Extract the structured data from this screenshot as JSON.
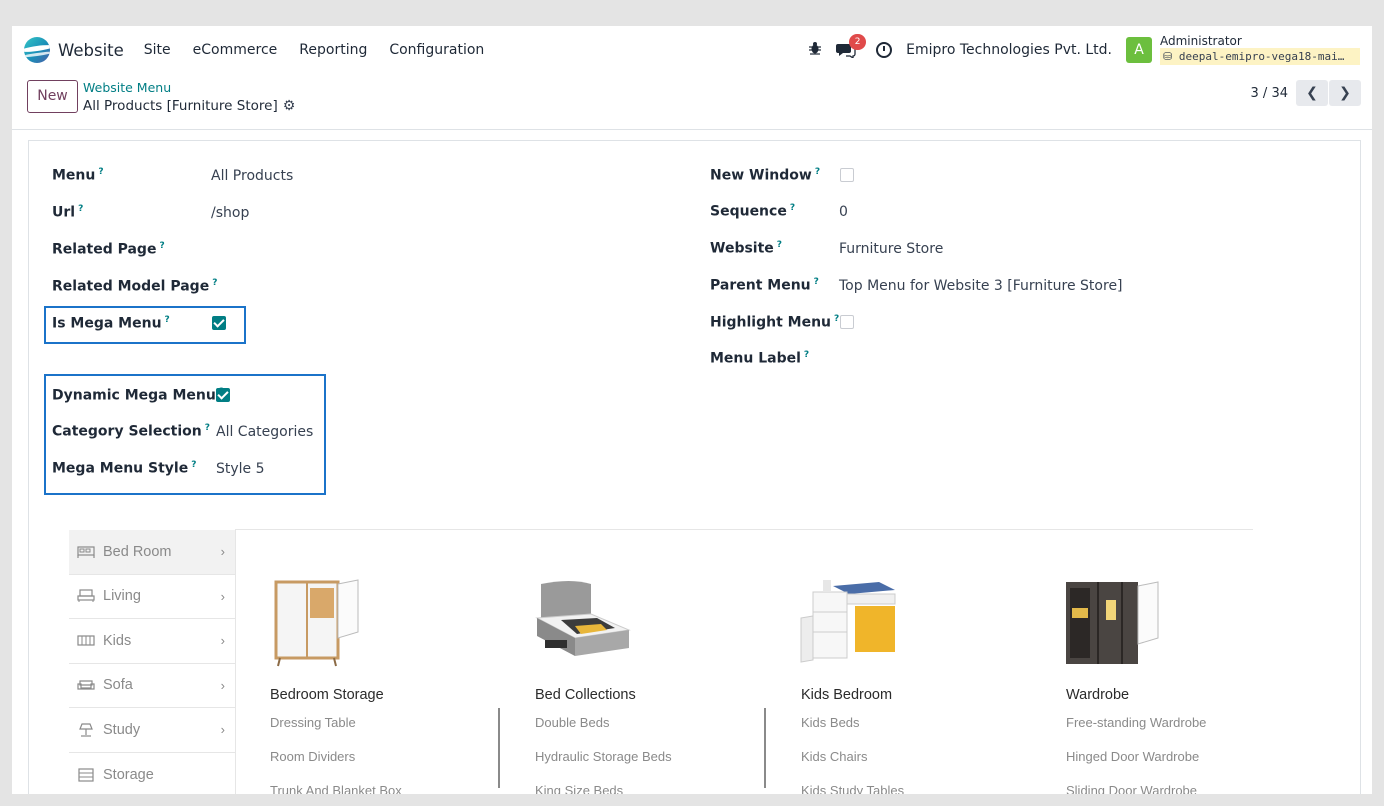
{
  "navbar": {
    "app_name": "Website",
    "menu": [
      "Site",
      "eCommerce",
      "Reporting",
      "Configuration"
    ],
    "messages_count": "2",
    "company": "Emipro Technologies Pvt. Ltd.",
    "user_initial": "A",
    "user_name": "Administrator",
    "database": "deepal-emipro-vega18-mai…"
  },
  "control": {
    "new_label": "New",
    "breadcrumb_parent": "Website Menu",
    "breadcrumb_current": "All Products [Furniture Store]",
    "pager": "3 / 34"
  },
  "form": {
    "left": [
      {
        "label": "Menu",
        "value": "All Products"
      },
      {
        "label": "Url",
        "value": "/shop"
      },
      {
        "label": "Related Page",
        "value": ""
      },
      {
        "label": "Related Model Page",
        "value": ""
      },
      {
        "label": "Is Mega Menu",
        "checked": true
      }
    ],
    "dynamic": [
      {
        "label": "Dynamic Mega Menu",
        "checked": true
      },
      {
        "label": "Category Selection",
        "value": "All Categories"
      },
      {
        "label": "Mega Menu Style",
        "value": "Style 5"
      }
    ],
    "right": [
      {
        "label": "New Window",
        "checked": false
      },
      {
        "label": "Sequence",
        "value": "0"
      },
      {
        "label": "Website",
        "value": "Furniture Store"
      },
      {
        "label": "Parent Menu",
        "value": "Top Menu for Website 3 [Furniture Store]"
      },
      {
        "label": "Highlight Menu",
        "checked": false
      },
      {
        "label": "Menu Label",
        "value": ""
      }
    ],
    "help_marker": "?"
  },
  "preview": {
    "categories": [
      {
        "label": "Bed Room",
        "icon": "bed-icon",
        "active": true
      },
      {
        "label": "Living",
        "icon": "living-icon",
        "active": false
      },
      {
        "label": "Kids",
        "icon": "crib-icon",
        "active": false
      },
      {
        "label": "Sofa",
        "icon": "sofa-icon",
        "active": false
      },
      {
        "label": "Study",
        "icon": "lamp-icon",
        "active": false
      },
      {
        "label": "Storage",
        "icon": "storage-icon",
        "active": false
      }
    ],
    "columns": [
      {
        "title": "Bedroom Storage",
        "links": [
          "Dressing Table",
          "Room Dividers",
          "Trunk And Blanket Box"
        ]
      },
      {
        "title": "Bed Collections",
        "links": [
          "Double Beds",
          "Hydraulic Storage Beds",
          "King Size Beds"
        ]
      },
      {
        "title": "Kids Bedroom",
        "links": [
          "Kids Beds",
          "Kids Chairs",
          "Kids Study Tables"
        ]
      },
      {
        "title": "Wardrobe",
        "links": [
          "Free-standing Wardrobe",
          "Hinged Door Wardrobe",
          "Sliding Door Wardrobe"
        ]
      }
    ]
  },
  "colors": {
    "accent": "#017e84",
    "brand_button": "#71405f",
    "highlight_border": "#1b73c9",
    "badge": "#e04a4a"
  }
}
